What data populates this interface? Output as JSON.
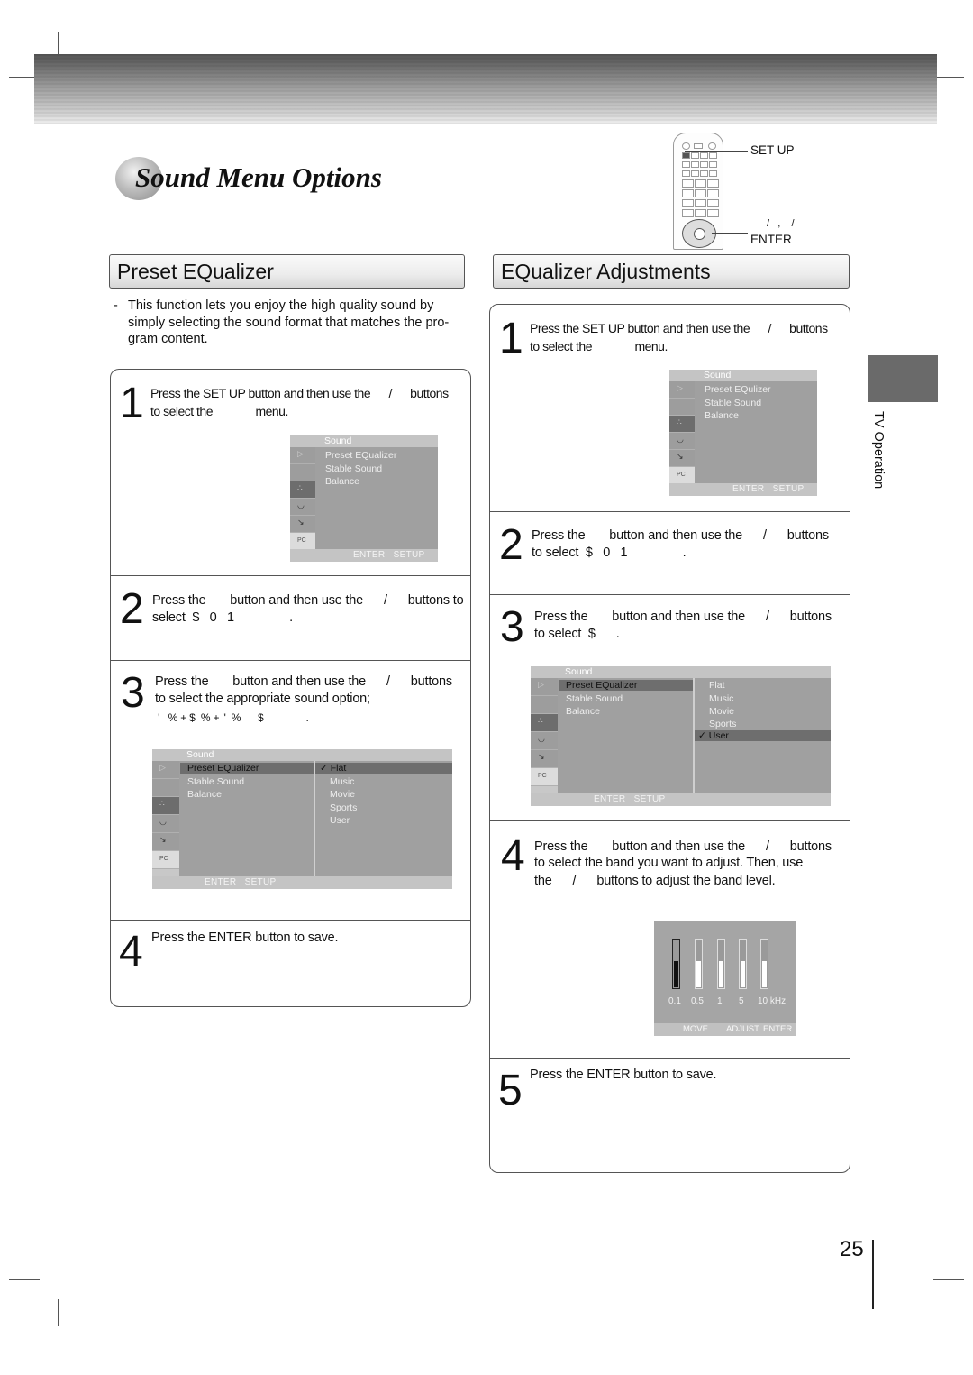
{
  "page": {
    "title": "Sound Menu Options",
    "side_tab": "TV Operation",
    "page_number": "25"
  },
  "remote": {
    "setup_label": "SET UP",
    "arrows_label": "/   ,    /",
    "enter_label": "ENTER"
  },
  "left": {
    "heading": "Preset EQualizer",
    "intro_dash": "-",
    "intro": "This function lets you enjoy the high quality sound by simply selecting the sound format that matches the pro-gram content.",
    "steps": [
      {
        "num": "1",
        "line1": "Press the SET UP button and then use the      /      buttons",
        "line2": "to select the              menu."
      },
      {
        "num": "2",
        "line1": "Press the       button and then use the      /      buttons to",
        "line2": "select  $   0   1                ."
      },
      {
        "num": "3",
        "line1": "Press the       button and then use the      /      buttons",
        "line2": "to select the appropriate sound option;",
        "line3": " '   % + $  % + \"  %      $               ."
      },
      {
        "num": "4",
        "line1": "Press the ENTER button to save."
      }
    ],
    "osd1": {
      "header": "Sound",
      "items": [
        "Preset EQualizer",
        "Stable Sound",
        "Balance"
      ],
      "footer": "ENTER   SETUP"
    },
    "osd2": {
      "header": "Sound",
      "items": [
        "Preset EQualizer",
        "Stable Sound",
        "Balance"
      ],
      "selected_item": "Preset EQualizer",
      "options": [
        "Flat",
        "Music",
        "Movie",
        "Sports",
        "User"
      ],
      "checked_option": "Flat",
      "check_mark": "✓",
      "footer": "ENTER   SETUP"
    }
  },
  "right": {
    "heading": "EQualizer Adjustments",
    "steps": [
      {
        "num": "1",
        "line1": "Press the SET UP button and then use the      /      buttons",
        "line2": "to select the              menu."
      },
      {
        "num": "2",
        "line1": "Press the       button and then use the      /      buttons",
        "line2": "to select  $   0   1                ."
      },
      {
        "num": "3",
        "line1": "Press the       button and then use the      /      buttons",
        "line2": "to select  $      ."
      },
      {
        "num": "4",
        "line1": "Press the       button and then use the      /      buttons",
        "line2": "to select the band you want to adjust. Then, use",
        "line3": "the      /      buttons to adjust the band level."
      },
      {
        "num": "5",
        "line1": "Press the ENTER button to save."
      }
    ],
    "osd1": {
      "header": "Sound",
      "items": [
        "Preset EQulizer",
        "Stable Sound",
        "Balance"
      ],
      "footer": "ENTER   SETUP"
    },
    "osd2": {
      "header": "Sound",
      "items": [
        "Preset EQualizer",
        "Stable Sound",
        "Balance"
      ],
      "selected_item": "Preset EQualizer",
      "options": [
        "Flat",
        "Music",
        "Movie",
        "Sports",
        "User"
      ],
      "checked_option": "User",
      "check_mark": "✓",
      "footer": "ENTER   SETUP"
    },
    "eq": {
      "bands": [
        {
          "freq": "0.1",
          "level": 0.55,
          "selected": true
        },
        {
          "freq": "0.5",
          "level": 0.55,
          "selected": false
        },
        {
          "freq": "1",
          "level": 0.55,
          "selected": false
        },
        {
          "freq": "5",
          "level": 0.55,
          "selected": false
        },
        {
          "freq": "10 kHz",
          "level": 0.55,
          "selected": false
        }
      ],
      "footer_move": "MOVE",
      "footer_adjust": "ADJUST",
      "footer_enter": "ENTER"
    }
  }
}
